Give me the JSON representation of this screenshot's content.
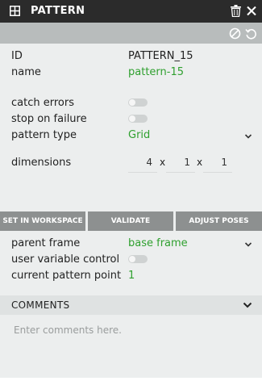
{
  "titlebar": {
    "title": "PATTERN",
    "icons": [
      "grid-icon",
      "trash-icon",
      "close-icon"
    ]
  },
  "actionbar": {
    "icons": [
      "ban-icon",
      "reset-icon"
    ]
  },
  "fields": {
    "id_label": "ID",
    "id_value": "PATTERN_15",
    "name_label": "name",
    "name_value": "pattern-15",
    "catch_errors_label": "catch errors",
    "catch_errors_value": false,
    "stop_on_failure_label": "stop on failure",
    "stop_on_failure_value": false,
    "pattern_type_label": "pattern type",
    "pattern_type_value": "Grid",
    "dimensions_label": "dimensions",
    "dimensions": [
      "4",
      "1",
      "1"
    ],
    "dimensions_sep": "x"
  },
  "buttons": {
    "set_in_workspace": "SET IN WORKSPACE",
    "validate": "VALIDATE",
    "adjust_poses": "ADJUST POSES"
  },
  "frame": {
    "parent_frame_label": "parent frame",
    "parent_frame_value": "base frame",
    "user_variable_control_label": "user variable control",
    "user_variable_control_value": false,
    "current_pattern_point_label": "current pattern point",
    "current_pattern_point_value": "1"
  },
  "comments": {
    "header": "COMMENTS",
    "placeholder": "Enter comments here."
  },
  "colors": {
    "accent_green": "#2fa02f",
    "titlebar": "#2b2b2b",
    "button": "#8d9090"
  }
}
